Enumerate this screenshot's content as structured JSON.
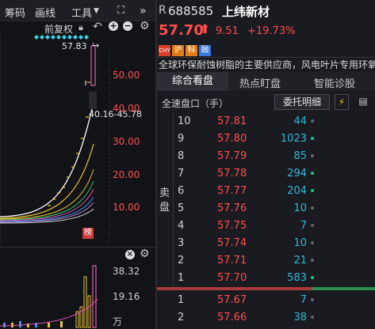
{
  "toolbar": {
    "items": [
      "筹码",
      "画线",
      "工具"
    ],
    "restore_label": "前复权",
    "icons": [
      "fullscreen-icon",
      "collapse-icon"
    ]
  },
  "chart": {
    "price_labels": [
      "50.00",
      "40.00",
      "30.00",
      "20.00",
      "10.00"
    ],
    "high_label": "57.83",
    "range_label": "40.16-45.78",
    "rank_badge": "榜",
    "vol_labels": [
      "38.32",
      "19.16",
      "万"
    ]
  },
  "stock": {
    "prefix": "R",
    "code": "688585",
    "name": "上纬新材",
    "price": "57.70",
    "change": "9.51",
    "change_pct": "+19.73%",
    "tags": [
      "CHY",
      "沪",
      "科",
      "融"
    ],
    "description": "全球环保耐蚀树脂的主要供应商，风电叶片专用环氧"
  },
  "tabs": [
    "综合看盘",
    "热点盯盘",
    "智能诊股"
  ],
  "market_label": "全速盘口（手）",
  "entrust_button": "委托明细",
  "sell_label": "卖盘",
  "asks": [
    {
      "level": "10",
      "price": "57.81",
      "vol": "44",
      "dot": "gray"
    },
    {
      "level": "9",
      "price": "57.80",
      "vol": "1023",
      "dot": "green"
    },
    {
      "level": "8",
      "price": "57.79",
      "vol": "85",
      "dot": "gray"
    },
    {
      "level": "7",
      "price": "57.78",
      "vol": "294",
      "dot": "green"
    },
    {
      "level": "6",
      "price": "57.77",
      "vol": "204",
      "dot": "green"
    },
    {
      "level": "5",
      "price": "57.76",
      "vol": "10",
      "dot": "gray"
    },
    {
      "level": "4",
      "price": "57.75",
      "vol": "7",
      "dot": "gray"
    },
    {
      "level": "3",
      "price": "57.74",
      "vol": "10",
      "dot": "gray"
    },
    {
      "level": "2",
      "price": "57.71",
      "vol": "21",
      "dot": "gray"
    },
    {
      "level": "1",
      "price": "57.70",
      "vol": "583",
      "dot": "green"
    }
  ],
  "bids": [
    {
      "level": "1",
      "price": "57.67",
      "vol": "7",
      "dot": "gray"
    },
    {
      "level": "2",
      "price": "57.66",
      "vol": "38",
      "dot": "gray"
    }
  ],
  "colors": {
    "up": "#ff4c4c",
    "vol": "#31b8d6",
    "green_dot": "#26c281",
    "gray_dot": "#666666"
  }
}
